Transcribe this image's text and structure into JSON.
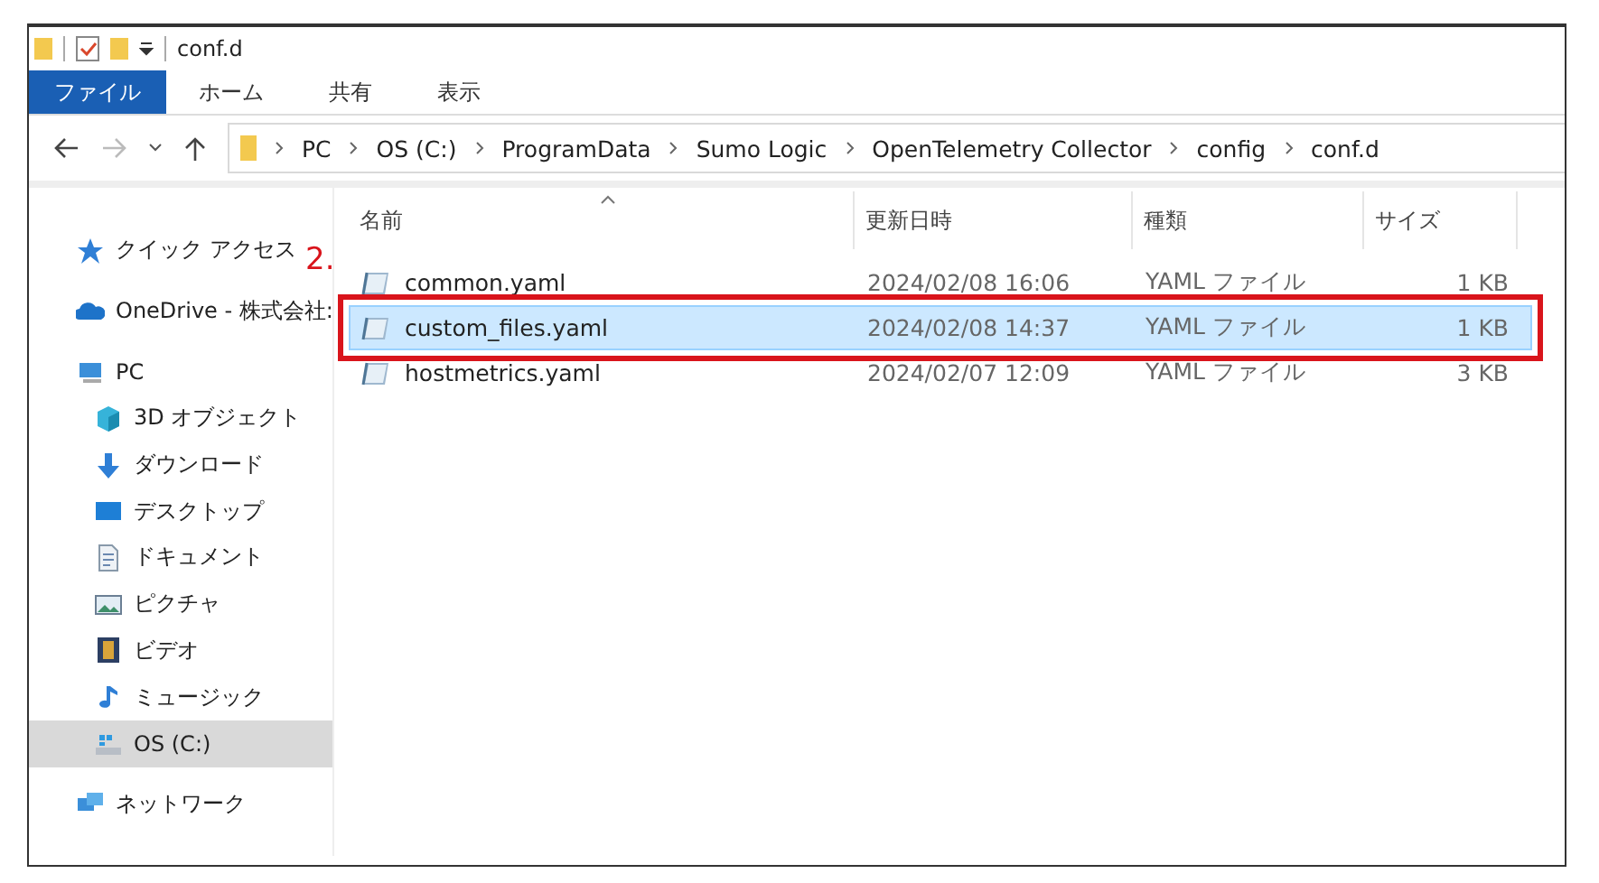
{
  "window": {
    "title": "conf.d"
  },
  "ribbon_tabs": [
    {
      "label": "ファイル",
      "kind": "file",
      "selected": false
    },
    {
      "label": "ホーム",
      "kind": "tab",
      "selected": false
    },
    {
      "label": "共有",
      "kind": "tab",
      "selected": false
    },
    {
      "label": "表示",
      "kind": "tab",
      "selected": false
    }
  ],
  "address_bar": {
    "path": [
      "PC",
      "OS (C:)",
      "ProgramData",
      "Sumo Logic",
      "OpenTelemetry Collector",
      "config",
      "conf.d"
    ]
  },
  "sidebar": {
    "groups": [
      {
        "items": [
          {
            "label": "クイック アクセス",
            "selected": false
          }
        ]
      },
      {
        "items": [
          {
            "label": "OneDrive - 株式会社:",
            "selected": false
          }
        ]
      },
      {
        "items": [
          {
            "label": "PC",
            "selected": false,
            "children": [
              {
                "label": "3D オブジェクト",
                "selected": false
              },
              {
                "label": "ダウンロード",
                "selected": false
              },
              {
                "label": "デスクトップ",
                "selected": false
              },
              {
                "label": "ドキュメント",
                "selected": false
              },
              {
                "label": "ピクチャ",
                "selected": false
              },
              {
                "label": "ビデオ",
                "selected": false
              },
              {
                "label": "ミュージック",
                "selected": false
              },
              {
                "label": "OS (C:)",
                "selected": true
              }
            ]
          }
        ]
      },
      {
        "items": [
          {
            "label": "ネットワーク",
            "selected": false
          }
        ]
      }
    ]
  },
  "file_list": {
    "columns": [
      "名前",
      "更新日時",
      "種類",
      "サイズ"
    ],
    "rows": [
      {
        "name": "common.yaml",
        "modified": "2024/02/08 16:06",
        "type": "YAML ファイル",
        "size": "1 KB",
        "selected": false,
        "highlighted": false
      },
      {
        "name": "custom_files.yaml",
        "modified": "2024/02/08 14:37",
        "type": "YAML ファイル",
        "size": "1 KB",
        "selected": true,
        "highlighted": true
      },
      {
        "name": "hostmetrics.yaml",
        "modified": "2024/02/07 12:09",
        "type": "YAML ファイル",
        "size": "3 KB",
        "selected": false,
        "highlighted": false
      }
    ]
  },
  "annotation": {
    "label": "2."
  }
}
